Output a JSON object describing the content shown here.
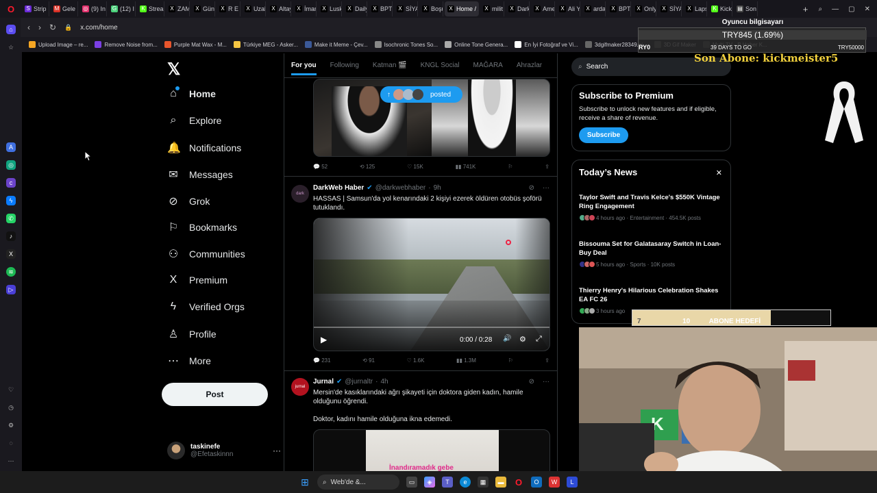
{
  "browser": {
    "tabs": [
      {
        "label": "Strip",
        "color": "#6c2bd9",
        "icon": "S"
      },
      {
        "label": "Gele",
        "color": "#d93025",
        "icon": "M"
      },
      {
        "label": "(9) In",
        "color": "#e1306c",
        "icon": "◎"
      },
      {
        "label": "(12) I",
        "color": "#4ad07a",
        "icon": "G"
      },
      {
        "label": "Strea",
        "color": "#53fc18",
        "icon": "K"
      },
      {
        "label": "ZAM",
        "color": "#000",
        "icon": "X"
      },
      {
        "label": "Günc",
        "color": "#000",
        "icon": "X"
      },
      {
        "label": "R E N",
        "color": "#000",
        "icon": "X"
      },
      {
        "label": "Uzak",
        "color": "#000",
        "icon": "X"
      },
      {
        "label": "Altay",
        "color": "#000",
        "icon": "X"
      },
      {
        "label": "İman",
        "color": "#000",
        "icon": "X"
      },
      {
        "label": "Lusk",
        "color": "#000",
        "icon": "X"
      },
      {
        "label": "Daily",
        "color": "#000",
        "icon": "X"
      },
      {
        "label": "BPT",
        "color": "#000",
        "icon": "X"
      },
      {
        "label": "SİYA",
        "color": "#000",
        "icon": "X"
      },
      {
        "label": "Boşu",
        "color": "#000",
        "icon": "X"
      },
      {
        "label": "Home / X",
        "color": "#000",
        "icon": "X",
        "active": true
      },
      {
        "label": "milit",
        "color": "#000",
        "icon": "X"
      },
      {
        "label": "Dark",
        "color": "#000",
        "icon": "X"
      },
      {
        "label": "Ame",
        "color": "#000",
        "icon": "X"
      },
      {
        "label": "Ali Yı",
        "color": "#000",
        "icon": "X"
      },
      {
        "label": "arda",
        "color": "#000",
        "icon": "X"
      },
      {
        "label": "BPT",
        "color": "#000",
        "icon": "X"
      },
      {
        "label": "Only",
        "color": "#000",
        "icon": "X"
      },
      {
        "label": "SİYA",
        "color": "#000",
        "icon": "X"
      },
      {
        "label": "Laps",
        "color": "#000",
        "icon": "X"
      },
      {
        "label": "Kick",
        "color": "#53fc18",
        "icon": "K"
      },
      {
        "label": "Son",
        "color": "#444",
        "icon": "▤"
      }
    ],
    "url": "x.com/home",
    "bookmarks": [
      {
        "label": "Upload Image – re...",
        "color": "#f5a623"
      },
      {
        "label": "Remove Noise from...",
        "color": "#7b3fe4"
      },
      {
        "label": "Purple Mat Wax - M...",
        "color": "#e8552c"
      },
      {
        "label": "Türkiye MEG - Asker...",
        "color": "#f5c542"
      },
      {
        "label": "Make it Meme - Çev...",
        "color": "#3b5998"
      },
      {
        "label": "Isochronic Tones So...",
        "color": "#888"
      },
      {
        "label": "Online Tone Genera...",
        "color": "#aaa"
      },
      {
        "label": "En İyi Fotoğraf ve Vi...",
        "color": "#fff"
      },
      {
        "label": "3dgifmaker28349.gi...",
        "color": "#666"
      },
      {
        "label": "3D Gif Maker",
        "color": "#555"
      },
      {
        "label": "Multi TV - B Haber K...",
        "color": "#444"
      }
    ]
  },
  "nav": {
    "items": [
      {
        "label": "Home",
        "icon": "⌂",
        "name": "home-icon"
      },
      {
        "label": "Explore",
        "icon": "⌕",
        "name": "search-icon"
      },
      {
        "label": "Notifications",
        "icon": "🔔",
        "name": "bell-icon"
      },
      {
        "label": "Messages",
        "icon": "✉",
        "name": "envelope-icon"
      },
      {
        "label": "Grok",
        "icon": "⊘",
        "name": "grok-icon"
      },
      {
        "label": "Bookmarks",
        "icon": "⚐",
        "name": "bookmark-icon"
      },
      {
        "label": "Communities",
        "icon": "⚇",
        "name": "communities-icon"
      },
      {
        "label": "Premium",
        "icon": "X",
        "name": "x-premium-icon"
      },
      {
        "label": "Verified Orgs",
        "icon": "ϟ",
        "name": "lightning-icon"
      },
      {
        "label": "Profile",
        "icon": "♙",
        "name": "person-icon"
      },
      {
        "label": "More",
        "icon": "⋯",
        "name": "more-circle-icon"
      }
    ],
    "post_label": "Post",
    "account_name": "taskinefe",
    "account_handle": "@Efetaskinnn"
  },
  "feed": {
    "tabs": [
      "For you",
      "Following",
      "Katman 🎬",
      "KNGL Social",
      "MAĞARA",
      "Ahrazlar"
    ],
    "posted_pill": "posted",
    "tweet1_actions": {
      "reply": "52",
      "retweet": "125",
      "like": "15K",
      "views": "741K"
    },
    "tweet2": {
      "name": "DarkWeb Haber",
      "handle": "@darkwebhaber",
      "time": "9h",
      "text": "HASSAS | Samsun'da yol kenarındaki 2 kişiyi ezerek öldüren otobüs şoförü tutuklandı.",
      "video_time": "0:00 / 0:28",
      "actions": {
        "reply": "231",
        "retweet": "91",
        "like": "1.6K",
        "views": "1.3M"
      }
    },
    "tweet3": {
      "name": "Jurnal",
      "handle": "@jurnaltr",
      "time": "4h",
      "text": "Mersin'de kasıklarındaki ağrı şikayeti için doktora giden kadın, hamile olduğunu öğrendi.",
      "text2": "Doktor, kadını hamile olduğuna ikna edemedi.",
      "caption": "İnandıramadık gebe"
    }
  },
  "sidebar": {
    "search_placeholder": "Search",
    "premium": {
      "title": "Subscribe to Premium",
      "body": "Subscribe to unlock new features and if eligible, receive a share of revenue.",
      "button": "Subscribe"
    },
    "news": {
      "title": "Today’s News",
      "items": [
        {
          "title": "Taylor Swift and Travis Kelce's $550K Vintage Ring Engagement",
          "meta": "4 hours ago · Entertainment · 454.5K posts"
        },
        {
          "title": "Bissouma Set for Galatasaray Switch in Loan-Buy Deal",
          "meta": "5 hours ago · Sports · 10K posts"
        },
        {
          "title": "Thierry Henry's Hilarious Celebration Shakes EA FC 26",
          "meta": "3 hours ago"
        }
      ]
    }
  },
  "stream": {
    "donate_title": "Oyuncu bilgisayarı",
    "donate_value": "TRY845 (1.69%)",
    "donate_left": "RY0",
    "donate_mid": "39 DAYS TO GO",
    "donate_right": "TRY50000",
    "donate_fraction": 0.0169,
    "last_sub": "Son Abone: kickmeister5",
    "goal_current": "7",
    "goal_label": "ABONE HEDEFİ",
    "goal_target": "10",
    "goal_fraction": 0.7
  },
  "taskbar": {
    "search_label": "Web'de &..."
  },
  "colors": {
    "accent": "#1d9bf0",
    "kick": "#53fc18",
    "gold": "#f2d13d"
  }
}
